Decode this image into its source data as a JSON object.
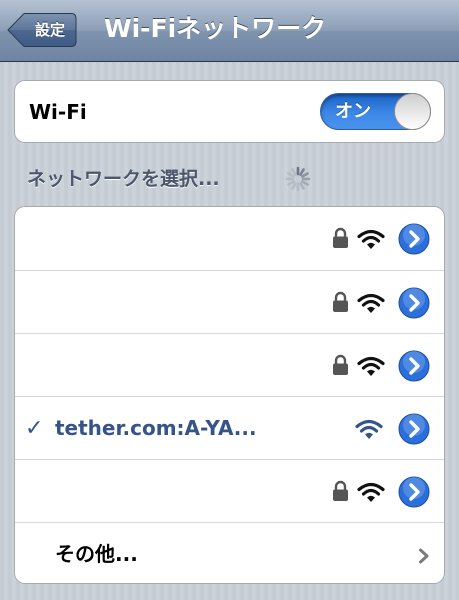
{
  "navbar": {
    "back_label": "設定",
    "title": "Wi-Fiネットワーク"
  },
  "wifi": {
    "label": "Wi-Fi",
    "toggle_label": "オン",
    "enabled": true
  },
  "section": {
    "header": "ネットワークを選択..."
  },
  "networks": [
    {
      "name": "",
      "locked": true,
      "connected": false
    },
    {
      "name": "",
      "locked": true,
      "connected": false
    },
    {
      "name": "",
      "locked": true,
      "connected": false
    },
    {
      "name": "tether.com:A-YA...",
      "locked": false,
      "connected": true,
      "check": "✓"
    },
    {
      "name": "",
      "locked": true,
      "connected": false
    }
  ],
  "other": {
    "label": "その他..."
  },
  "colors": {
    "accent": "#34548a",
    "toggle_on": "#3d87e6",
    "disclosure": "#2a6fdb"
  },
  "icons": [
    "back-arrow-icon",
    "spinner-icon",
    "lock-icon",
    "wifi-icon",
    "disclosure-icon",
    "checkmark-icon",
    "chevron-right-icon"
  ]
}
